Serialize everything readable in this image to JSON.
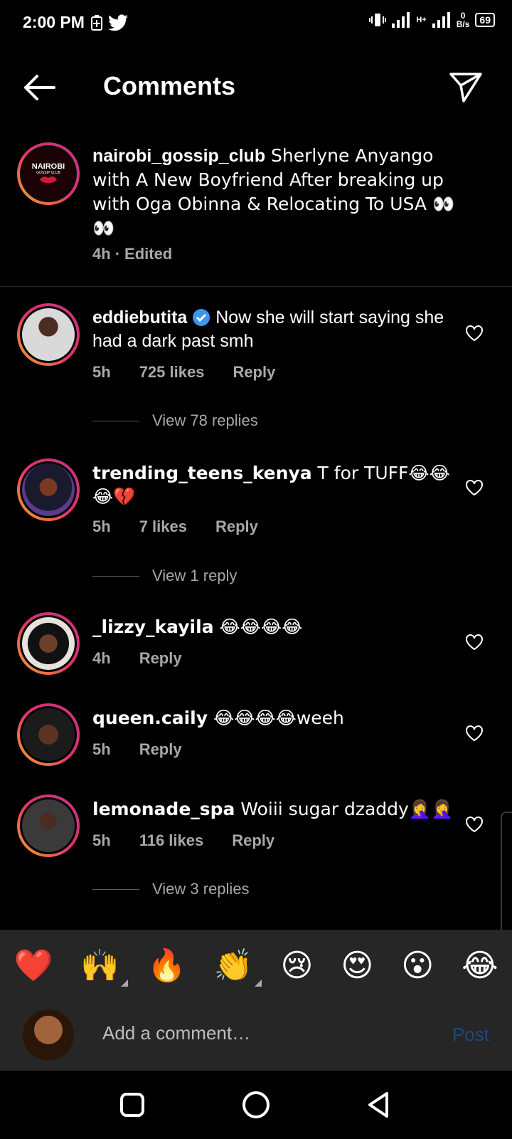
{
  "status": {
    "time": "2:00 PM",
    "battery": "69",
    "network_speed_value": "0",
    "network_speed_unit": "B/s",
    "network_type": "H+"
  },
  "header": {
    "title": "Comments"
  },
  "caption": {
    "username": "nairobi_gossip_club",
    "text": " Sherlyne Anyango with A New Boyfriend After breaking up with Oga Obinna & Relocating To USA 👀👀",
    "time": "4h",
    "edited": "Edited",
    "avatar_text": "NAIROBI",
    "avatar_subtext": "GOSSIP CLUB"
  },
  "comments": [
    {
      "username": "eddiebutita",
      "verified": true,
      "text": " Now she will start saying she had a dark past smh",
      "time": "5h",
      "likes": "725 likes",
      "reply": "Reply",
      "view_replies": "View 78 replies"
    },
    {
      "username": "trending_teens_kenya",
      "verified": false,
      "text": " T for TUFF😂😂😂💔",
      "time": "5h",
      "likes": "7 likes",
      "reply": "Reply",
      "view_replies": "View 1 reply"
    },
    {
      "username": "_lizzy_kayila",
      "verified": false,
      "text": " 😂😂😂😂",
      "time": "4h",
      "likes": "",
      "reply": "Reply",
      "view_replies": ""
    },
    {
      "username": "queen.caily",
      "verified": false,
      "text": " 😂😂😂😂weeh",
      "time": "5h",
      "likes": "",
      "reply": "Reply",
      "view_replies": ""
    },
    {
      "username": "lemonade_spa",
      "verified": false,
      "text": " Woiii sugar dzaddy🤦‍♀️🤦‍♀️",
      "time": "5h",
      "likes": "116 likes",
      "reply": "Reply",
      "view_replies": "View 3 replies"
    }
  ],
  "reactions": [
    "❤️",
    "🙌",
    "🔥",
    "👏",
    "😢",
    "😍",
    "😮",
    "😂"
  ],
  "composer": {
    "placeholder": "Add a comment…",
    "post_label": "Post"
  }
}
